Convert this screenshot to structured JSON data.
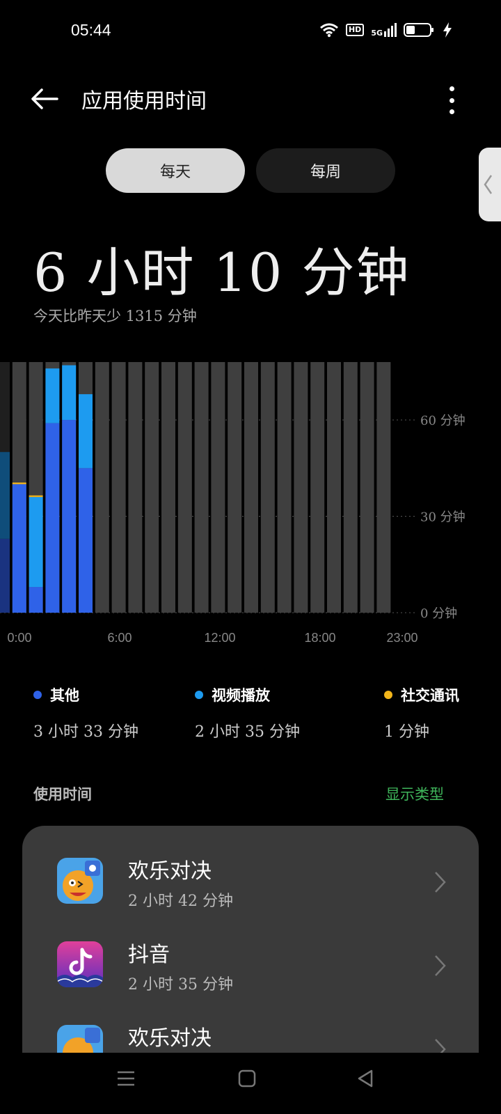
{
  "status": {
    "time": "05:44",
    "hd": "HD",
    "net": "5G"
  },
  "header": {
    "title": "应用使用时间"
  },
  "segments": {
    "daily": "每天",
    "weekly": "每周"
  },
  "summary": {
    "total": "6 小时 10 分钟",
    "compare": "今天比昨天少 1315 分钟"
  },
  "chart_data": {
    "type": "bar",
    "categories": [
      "0",
      "1",
      "2",
      "3",
      "4",
      "5",
      "6",
      "7",
      "8",
      "9",
      "10",
      "11",
      "12",
      "13",
      "14",
      "15",
      "16",
      "17",
      "18",
      "19",
      "20",
      "21",
      "22",
      "23"
    ],
    "series": [
      {
        "name": "其他",
        "color": "#2f62e8",
        "values": [
          0,
          40,
          8,
          59,
          60,
          45,
          0,
          0,
          0,
          0,
          0,
          0,
          0,
          0,
          0,
          0,
          0,
          0,
          0,
          0,
          0,
          0,
          0,
          0
        ]
      },
      {
        "name": "视频播放",
        "color": "#1d9bf0",
        "values": [
          0,
          0,
          28,
          17,
          17,
          23,
          0,
          0,
          0,
          0,
          0,
          0,
          0,
          0,
          0,
          0,
          0,
          0,
          0,
          0,
          0,
          0,
          0,
          0
        ]
      },
      {
        "name": "社交通讯",
        "color": "#f2b51a",
        "values": [
          0,
          0.5,
          0.5,
          0,
          0,
          0,
          0,
          0,
          0,
          0,
          0,
          0,
          0,
          0,
          0,
          0,
          0,
          0,
          0,
          0,
          0,
          0,
          0,
          0
        ]
      }
    ],
    "xticks": [
      "0:00",
      "6:00",
      "12:00",
      "18:00",
      "23:00"
    ],
    "yticks": [
      "0 分钟",
      "30 分钟",
      "60 分钟"
    ],
    "ylim": [
      0,
      78
    ]
  },
  "legend": [
    {
      "name": "其他",
      "value": "3 小时 33 分钟",
      "color": "#2f62e8"
    },
    {
      "name": "视频播放",
      "value": "2 小时 35 分钟",
      "color": "#1d9bf0"
    },
    {
      "name": "社交通讯",
      "value": "1 分钟",
      "color": "#f2b51a"
    }
  ],
  "section": {
    "title": "使用时间",
    "action": "显示类型"
  },
  "apps": [
    {
      "name": "欢乐对决",
      "time": "2 小时 42 分钟",
      "icon": "game-icon"
    },
    {
      "name": "抖音",
      "time": "2 小时 35 分钟",
      "icon": "tiktok-icon"
    },
    {
      "name": "欢乐对决",
      "time": "",
      "icon": "game-icon"
    }
  ]
}
